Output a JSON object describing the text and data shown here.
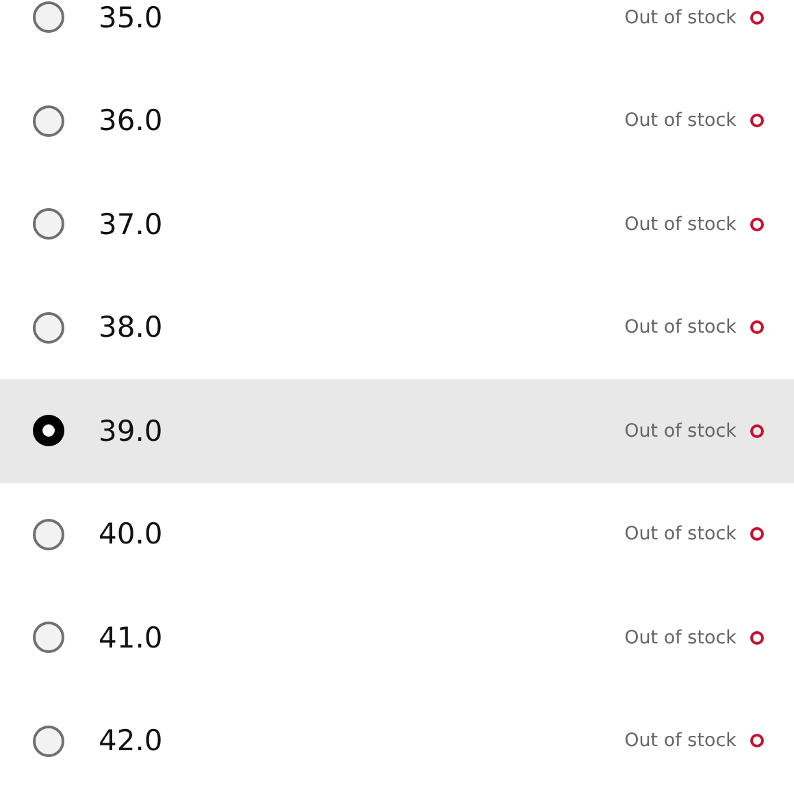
{
  "sizes": [
    {
      "label": "35.0",
      "status": "Out of stock",
      "selected": false
    },
    {
      "label": "36.0",
      "status": "Out of stock",
      "selected": false
    },
    {
      "label": "37.0",
      "status": "Out of stock",
      "selected": false
    },
    {
      "label": "38.0",
      "status": "Out of stock",
      "selected": false
    },
    {
      "label": "39.0",
      "status": "Out of stock",
      "selected": true
    },
    {
      "label": "40.0",
      "status": "Out of stock",
      "selected": false
    },
    {
      "label": "41.0",
      "status": "Out of stock",
      "selected": false
    },
    {
      "label": "42.0",
      "status": "Out of stock",
      "selected": false
    }
  ]
}
